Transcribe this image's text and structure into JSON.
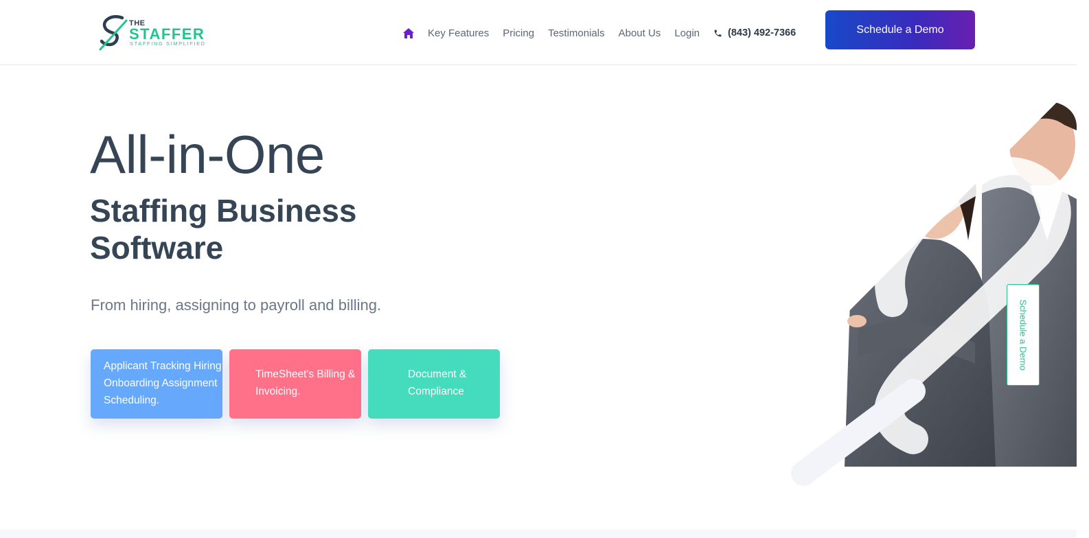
{
  "logo": {
    "the": "THE",
    "name": "STAFFER",
    "tagline": "STAFFING SIMPLIFIED"
  },
  "nav": {
    "home_icon": "home-icon",
    "items": [
      "Key Features",
      "Pricing",
      "Testimonials",
      "About Us",
      "Login"
    ],
    "phone_icon": "phone-icon",
    "phone": "(843) 492-7366",
    "cta": "Schedule a Demo"
  },
  "hero": {
    "title": "All-in-One",
    "subtitle": "Staffing Business Software",
    "tagline": "From hiring, assigning to payroll and billing.",
    "cards": [
      {
        "lines": [
          "Applicant Tracking Hiring",
          "Onboarding Assignment",
          "Scheduling."
        ],
        "color": "#66a8fc"
      },
      {
        "lines": [
          "TimeSheet's Billing &",
          "Invoicing."
        ],
        "color": "#ff7089"
      },
      {
        "lines": [
          "Document &",
          "Compliance"
        ],
        "color": "#44dcbc"
      }
    ]
  },
  "side_tab": "Schedule a Demo",
  "colors": {
    "brand_green": "#22c58b",
    "text_dark": "#354555",
    "cta_gradient_start": "#1849c8",
    "cta_gradient_end": "#6a1fb0",
    "home_icon": "#6a1fd0"
  }
}
